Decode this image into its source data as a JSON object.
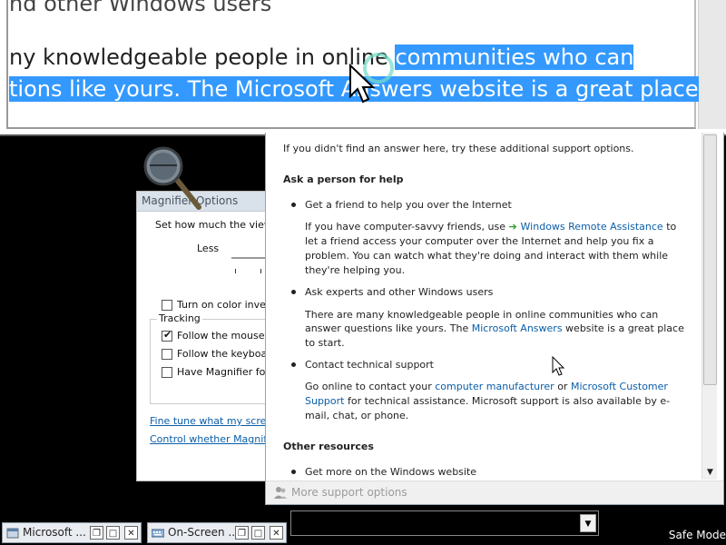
{
  "lens": {
    "line1": "nd other Windows users",
    "line2_plain": "ny knowledgeable people in online ",
    "line2_selected": "communities who can",
    "line3_selected": "tions like yours. The Microsoft Answers website is a great place"
  },
  "magnifier_options": {
    "title": "Magnifier Options",
    "zoom_label": "Set how much the view",
    "less_label": "Less",
    "color_inversion_label": "Turn on color inver",
    "tracking_label": "Tracking",
    "follow_mouse_label": "Follow the mouse",
    "follow_mouse_checked": true,
    "follow_keyboard_label": "Follow the keyboa",
    "follow_keyboard_checked": false,
    "follow_focus_label": "Have Magnifier fol",
    "follow_focus_checked": false,
    "color_inversion_checked": false,
    "fine_tune_link": "Fine tune what my scree",
    "control_link": "Control whether Magnif"
  },
  "help": {
    "intro": "If you didn't find an answer here, try these additional support options.",
    "ask_heading": "Ask a person for help",
    "friend_bullet": "Get a friend to help you over the Internet",
    "friend_text_pre": "If you have computer-savvy friends, use ",
    "friend_link": "Windows Remote Assistance",
    "friend_text_to": " to",
    "friend_text_line2": "let a friend access your computer over the Internet and help you fix a",
    "friend_text_line3": "problem. You can watch what they're doing and interact with them while",
    "friend_text_line4": "they're helping you.",
    "experts_bullet": "Ask experts and other Windows users",
    "experts_line1": "There are many knowledgeable people in online communities who can",
    "experts_line2_pre": "answer questions like yours. The ",
    "experts_link": "Microsoft Answers",
    "experts_line2_post": " website is a great place",
    "experts_line3": "to start.",
    "tech_bullet": "Contact technical support",
    "tech_line1_pre": "Go online to contact your ",
    "tech_link1": "computer manufacturer",
    "tech_line1_mid": " or ",
    "tech_link2a": "Microsoft Customer",
    "tech_link2b": "Support",
    "tech_line2_post": " for technical assistance. Microsoft support is also available by e-",
    "tech_line3": "mail, chat, or phone.",
    "other_heading": "Other resources",
    "more_bullet": "Get more on the Windows website",
    "footer": "More support options"
  },
  "taskbar": {
    "item1": "Microsoft ...",
    "item2": "On-Screen ...",
    "safe_mode": "Safe Mode"
  },
  "colors": {
    "selection": "#3399ff",
    "link": "#0b5ea8"
  }
}
